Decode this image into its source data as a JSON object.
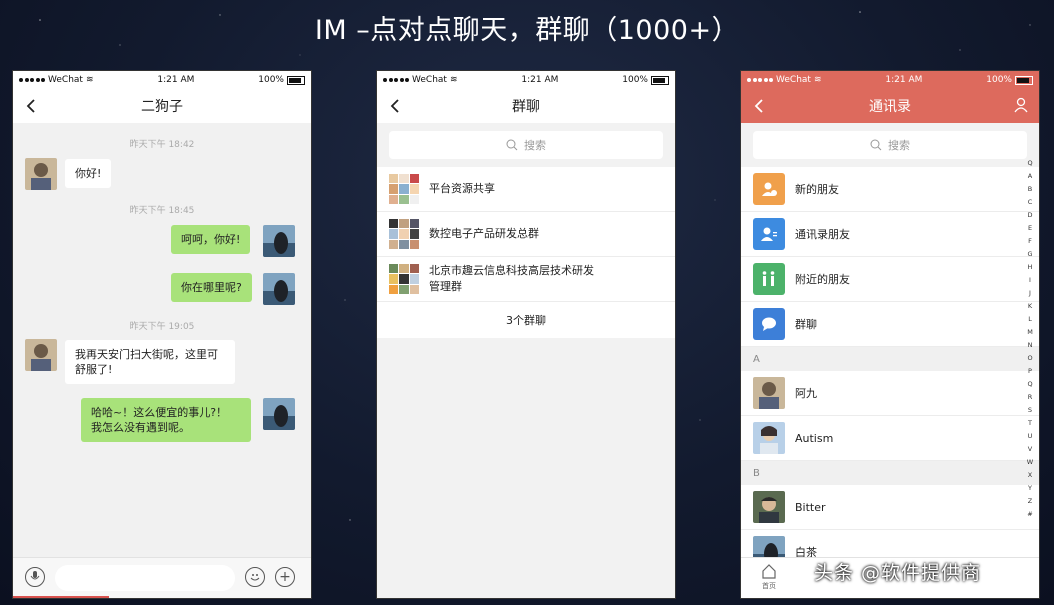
{
  "slide": {
    "title": "IM –点对点聊天，群聊（1000+）"
  },
  "status": {
    "carrier": "WeChat",
    "time": "1:21 AM",
    "battery": "100%"
  },
  "chat": {
    "title": "二狗子",
    "messages": [
      {
        "time": "昨天下午 18:42"
      },
      {
        "text": "你好!"
      },
      {
        "time": "昨天下午 18:45"
      },
      {
        "text": "呵呵，你好!"
      },
      {
        "text": "你在哪里呢?"
      },
      {
        "time": "昨天下午 19:05"
      },
      {
        "line1": "我再天安门扫大街呢，这里可",
        "line2": "舒服了!"
      },
      {
        "line1": "哈哈~！这么便宜的事儿?！",
        "line2": "我怎么没有遇到呢。"
      }
    ]
  },
  "group": {
    "title": "群聊",
    "search_placeholder": "搜索",
    "items": [
      {
        "name": "平台资源共享"
      },
      {
        "name": "数控电子产品研发总群"
      },
      {
        "line1": "北京市趣云信息科技高层技术研发",
        "line2": "管理群"
      }
    ],
    "count": "3个群聊"
  },
  "contacts": {
    "title": "通讯录",
    "search_placeholder": "搜索",
    "colors": {
      "header": "#dd6a5d",
      "orange": "#f0a04b",
      "blue": "#3d8be0",
      "green": "#4cb26a",
      "blue2": "#3d7fd8"
    },
    "functions": [
      {
        "label": "新的朋友"
      },
      {
        "label": "通讯录朋友"
      },
      {
        "label": "附近的朋友"
      },
      {
        "label": "群聊"
      }
    ],
    "section_a": "A",
    "a_items": [
      {
        "name": "阿九"
      },
      {
        "name": "Autism"
      }
    ],
    "section_b": "B",
    "b_items": [
      {
        "name": "Bitter"
      },
      {
        "name": "白茶"
      }
    ],
    "alphabet": [
      "Q",
      "A",
      "B",
      "C",
      "D",
      "E",
      "F",
      "G",
      "H",
      "I",
      "J",
      "K",
      "L",
      "M",
      "N",
      "O",
      "P",
      "Q",
      "R",
      "S",
      "T",
      "U",
      "V",
      "W",
      "X",
      "Y",
      "Z",
      "#"
    ],
    "tab_home": "首页"
  },
  "watermark": "头条 @软件提供商"
}
